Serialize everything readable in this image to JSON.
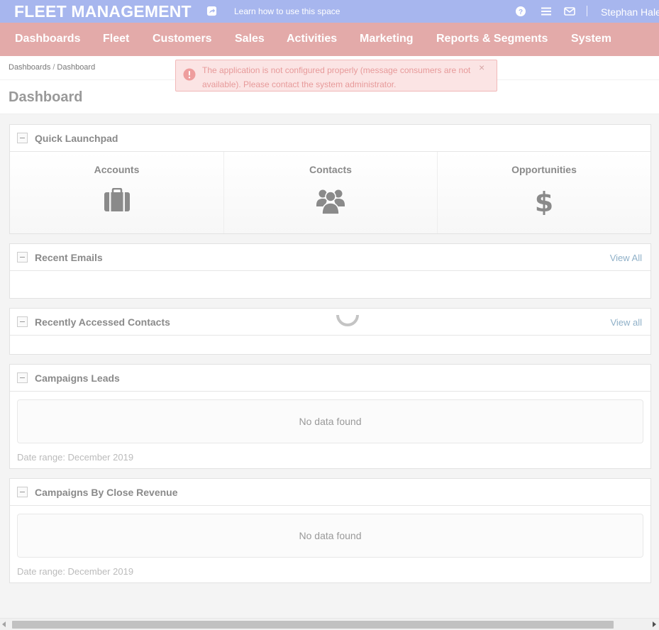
{
  "topbar": {
    "title": "FLEET MANAGEMENT",
    "help_link": "Learn how to use this space",
    "help_link_icon": "share-square-icon",
    "icons": [
      "question-circle-icon",
      "list-icon",
      "envelope-icon"
    ],
    "user_name": "Stephan Hale"
  },
  "nav": {
    "items": [
      "Dashboards",
      "Fleet",
      "Customers",
      "Sales",
      "Activities",
      "Marketing",
      "Reports & Segments",
      "System"
    ]
  },
  "breadcrumb": {
    "items": [
      "Dashboards",
      "Dashboard"
    ],
    "separator": "/"
  },
  "page": {
    "title": "Dashboard"
  },
  "alert": {
    "message": "The application is not configured properly (message consumers are not available). Please contact the system administrator.",
    "close_label": "×",
    "icon": "exclamation-circle-icon"
  },
  "widgets": {
    "quick_launchpad": {
      "title": "Quick Launchpad",
      "items": [
        {
          "label": "Accounts",
          "icon": "briefcase-icon"
        },
        {
          "label": "Contacts",
          "icon": "users-icon"
        },
        {
          "label": "Opportunities",
          "icon": "dollar-icon"
        }
      ]
    },
    "recent_emails": {
      "title": "Recent Emails",
      "link": "View All"
    },
    "recent_contacts": {
      "title": "Recently Accessed Contacts",
      "link": "View all"
    },
    "campaigns_leads": {
      "title": "Campaigns Leads",
      "empty_text": "No data found",
      "date_range": "Date range: December 2019"
    },
    "campaigns_revenue": {
      "title": "Campaigns By Close Revenue",
      "empty_text": "No data found",
      "date_range": "Date range: December 2019"
    }
  },
  "colors": {
    "topbar": "#a7b6ee",
    "nav": "#e3aaa9",
    "alert_bg": "#fbe4e4",
    "alert_text": "#e79a9a",
    "link": "#8fb0c8"
  }
}
